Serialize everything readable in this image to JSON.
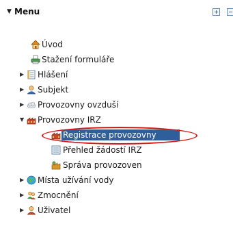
{
  "header": {
    "title": "Menu"
  },
  "menu": {
    "uvod": "Úvod",
    "stazeni": "Stažení formuláře",
    "hlaseni": "Hlášení",
    "subjekt": "Subjekt",
    "ovzdusi": "Provozovny ovzduší",
    "irz": "Provozovny IRZ",
    "registrace": "Registrace provozovny",
    "prehled": "Přehled žádostí IRZ",
    "sprava": "Správa provozoven",
    "vody": "Místa užívání vody",
    "zmocneni": "Zmocnění",
    "uzivatel": "Uživatel"
  },
  "colors": {
    "selection": "#2f5f9a",
    "highlight_ring": "#d81818"
  }
}
